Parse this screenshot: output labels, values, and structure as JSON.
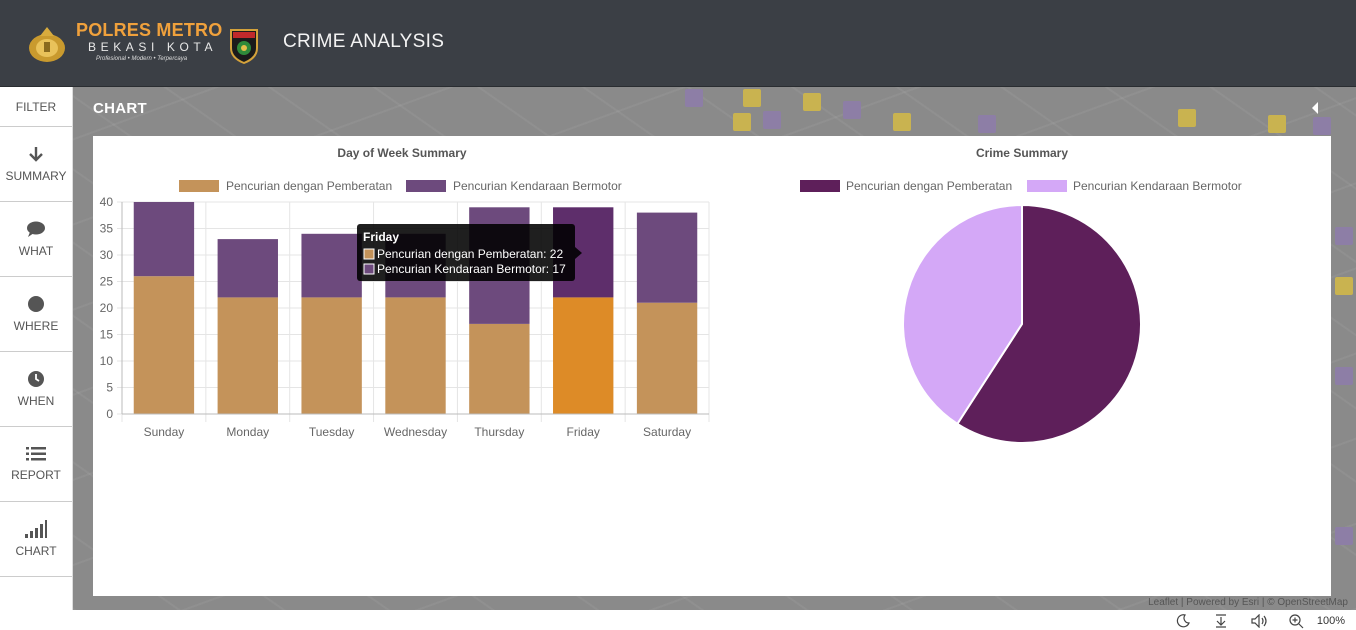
{
  "header": {
    "brand_line1": "POLRES METRO",
    "brand_line2": "BEKASI KOTA",
    "brand_tagline": "Profesional • Modern • Terpercaya",
    "app_title": "CRIME ANALYSIS"
  },
  "sidebar": {
    "filter_label": "FILTER",
    "items": [
      {
        "label": "SUMMARY",
        "icon": "arrow-down-icon"
      },
      {
        "label": "WHAT",
        "icon": "speech-bubble-icon"
      },
      {
        "label": "WHERE",
        "icon": "circle-icon"
      },
      {
        "label": "WHEN",
        "icon": "clock-icon"
      },
      {
        "label": "REPORT",
        "icon": "list-icon"
      },
      {
        "label": "CHART",
        "icon": "signal-bars-icon"
      }
    ]
  },
  "main": {
    "title": "CHART",
    "map_attribution": "Leaflet | Powered by Esri | © OpenStreetMap"
  },
  "colors": {
    "pemberatan": "#c4935a",
    "kendaraan": "#6d4a7d",
    "highlight_pemberatan": "#dd8b27",
    "highlight_kendaraan": "#5e2e6b",
    "pie_pemberatan": "#5e1f5a",
    "pie_kendaraan": "#d4a8f7"
  },
  "chart_data": [
    {
      "type": "bar",
      "stacked": true,
      "title": "Day of Week Summary",
      "categories": [
        "Sunday",
        "Monday",
        "Tuesday",
        "Wednesday",
        "Thursday",
        "Friday",
        "Saturday"
      ],
      "series": [
        {
          "name": "Pencurian dengan Pemberatan",
          "values": [
            26,
            22,
            22,
            22,
            17,
            22,
            21
          ]
        },
        {
          "name": "Pencurian Kendaraan Bermotor",
          "values": [
            14,
            11,
            12,
            12,
            22,
            17,
            17
          ]
        }
      ],
      "yticks": [
        "0",
        "5",
        "10",
        "15",
        "20",
        "25",
        "30",
        "35",
        "40"
      ],
      "ylim": [
        0,
        40
      ],
      "legend": "top",
      "grid": true,
      "tooltip": {
        "title": "Friday",
        "lines": [
          "Pencurian dengan Pemberatan: 22",
          "Pencurian Kendaraan Bermotor: 17"
        ]
      }
    },
    {
      "type": "pie",
      "title": "Crime Summary",
      "labels": [
        "Pencurian dengan Pemberatan",
        "Pencurian Kendaraan Bermotor"
      ],
      "values": [
        152,
        105
      ],
      "legend": "top"
    }
  ],
  "statusbar": {
    "zoom": "100%"
  }
}
